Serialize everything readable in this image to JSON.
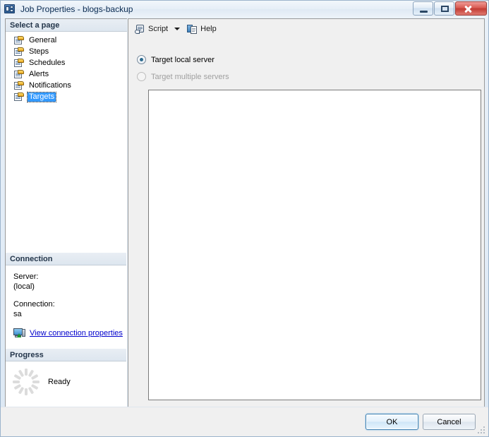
{
  "window": {
    "title": "Job Properties - blogs-backup",
    "icon": "job-properties-icon",
    "minimize_tooltip": "Minimize",
    "maximize_tooltip": "Maximize",
    "close_tooltip": "Close"
  },
  "left_pane": {
    "select_page": {
      "header": "Select a page",
      "items": [
        {
          "label": "General",
          "selected": false
        },
        {
          "label": "Steps",
          "selected": false
        },
        {
          "label": "Schedules",
          "selected": false
        },
        {
          "label": "Alerts",
          "selected": false
        },
        {
          "label": "Notifications",
          "selected": false
        },
        {
          "label": "Targets",
          "selected": true
        }
      ]
    },
    "connection": {
      "header": "Connection",
      "server_label": "Server:",
      "server_value": "(local)",
      "connection_label": "Connection:",
      "connection_value": "sa",
      "link": "View connection properties",
      "link_color": "#0000cc"
    },
    "progress": {
      "header": "Progress",
      "status": "Ready"
    }
  },
  "right_pane": {
    "toolbar": {
      "script_label": "Script",
      "script_icon": "script-scroll-icon",
      "dropdown_icon": "chevron-down-icon",
      "help_label": "Help",
      "help_icon": "help-document-icon"
    },
    "options": {
      "target_local": {
        "label": "Target local server",
        "checked": true,
        "disabled": false
      },
      "target_multiple": {
        "label": "Target multiple servers",
        "checked": false,
        "disabled": true
      }
    },
    "server_list": {
      "name": "target-servers-list",
      "items": []
    }
  },
  "footer": {
    "ok_label": "OK",
    "cancel_label": "Cancel"
  },
  "colors": {
    "selection_blue": "#3399ff",
    "title_text": "#0b2c52",
    "close_red": "#c23c34",
    "accent_blue": "#3c7fb1"
  }
}
